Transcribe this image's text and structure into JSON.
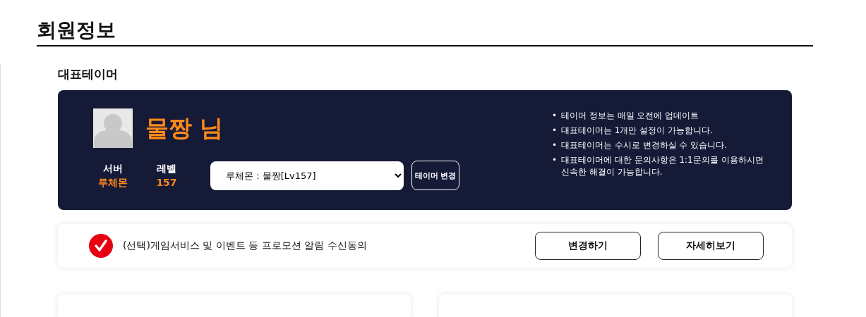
{
  "page_title": "회원정보",
  "section_title": "대표테이머",
  "tamer": {
    "name": "물짱 님",
    "server_label": "서버",
    "server": "루체몬",
    "level_label": "레벨",
    "level": "157",
    "select_value": "루체몬 : 물짱[Lv157]",
    "change_button": "테이머 변경"
  },
  "notes": [
    {
      "bullet": "•",
      "text": "테이머 정보는 매일 오전에 업데이트"
    },
    {
      "bullet": "•",
      "text": "대표테이머는 1개만 설정이 가능합니다."
    },
    {
      "bullet": "•",
      "text": "대표테이머는 수시로 변경하실 수 있습니다."
    },
    {
      "bullet": "•",
      "text": "대표테이머에 대한 문의사항은 1:1문의를 이용하시면 신속한 해결이 가능합니다."
    }
  ],
  "consent": {
    "checked": true,
    "label": "(선택)게임서비스 및 이벤트 등 프로모션 알림 수신동의",
    "buttons": [
      "변경하기",
      "자세히보기"
    ]
  }
}
